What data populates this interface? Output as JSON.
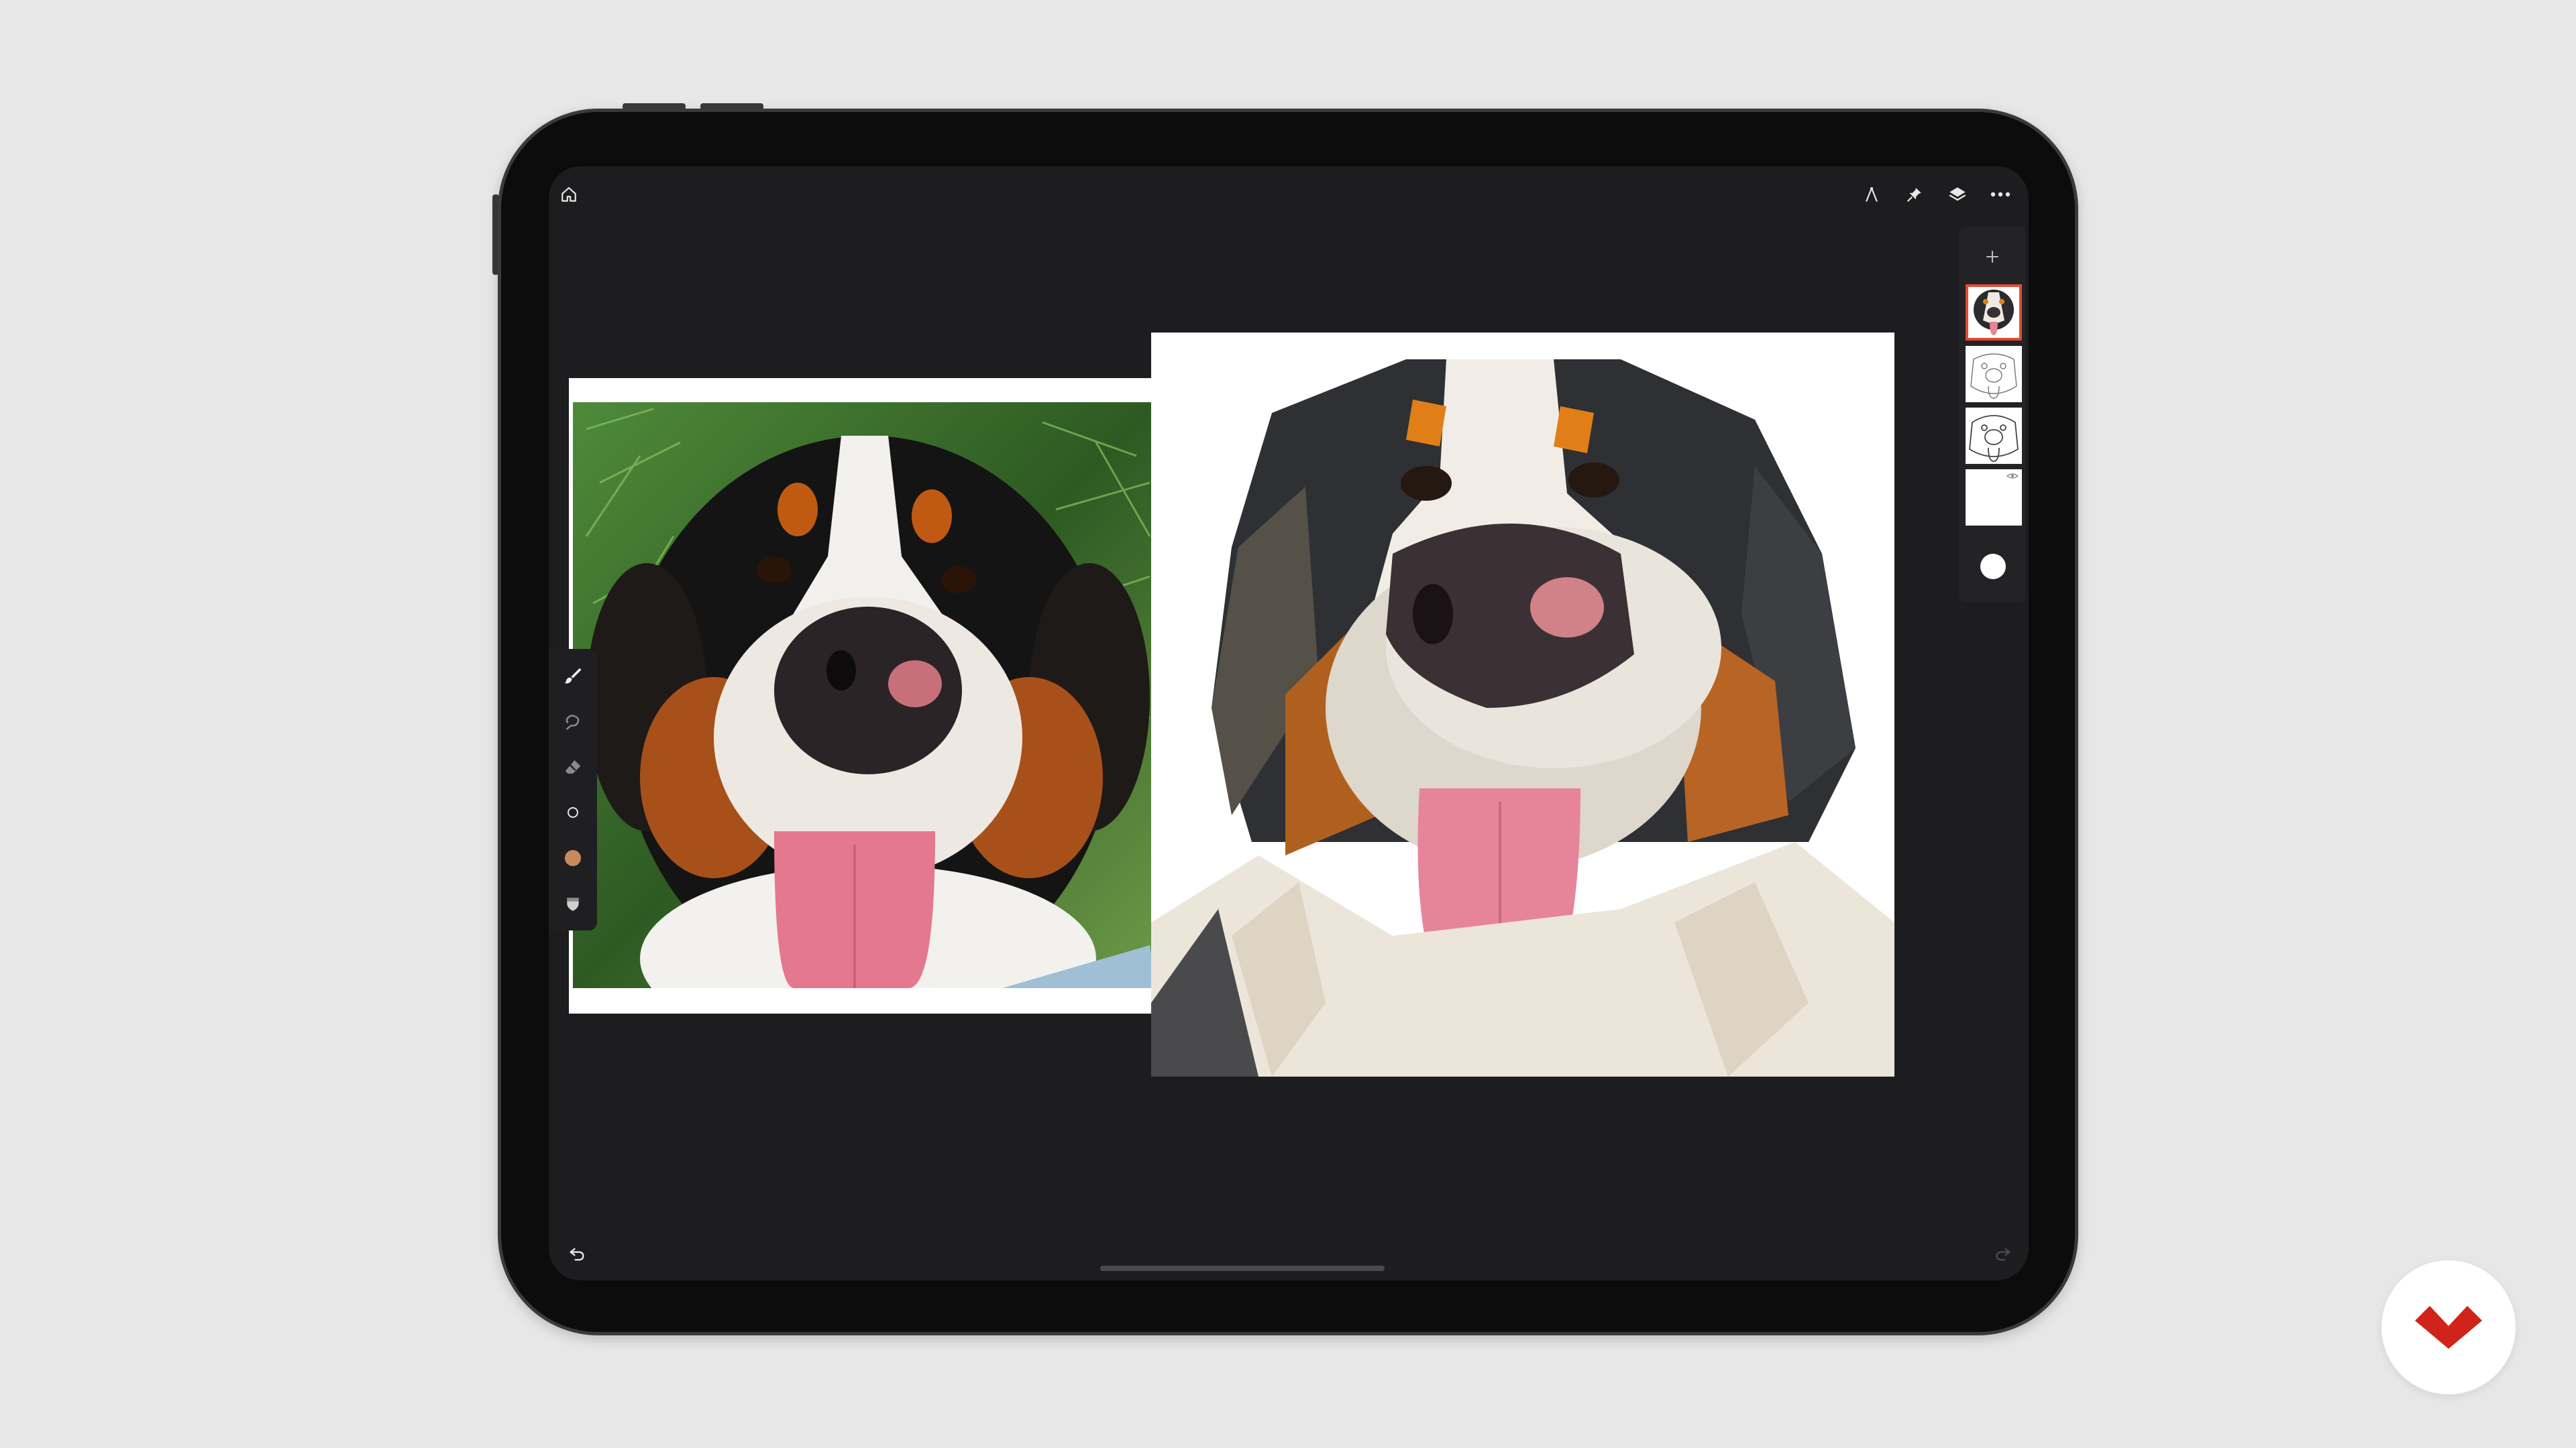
{
  "app": {
    "toolbar_left": [
      "home-icon"
    ],
    "toolbar_right": [
      "compass-icon",
      "pin-icon",
      "layers-icon",
      "more-icon"
    ],
    "undo_icon": "undo-icon",
    "redo_icon": "redo-icon"
  },
  "layers": {
    "add_icon": "plus-icon",
    "items": [
      {
        "thumb": "color-dog-portrait",
        "active": true
      },
      {
        "thumb": "line-sketch-1",
        "active": false
      },
      {
        "thumb": "line-sketch-2",
        "active": false
      },
      {
        "thumb": "blank-layer",
        "active": false
      }
    ],
    "visibility_icon": "eye-icon",
    "selected_color_icon": "color-dot"
  },
  "tools": [
    {
      "name": "brush-tool",
      "icon": "brush-icon"
    },
    {
      "name": "smudge-tool",
      "icon": "smudge-icon"
    },
    {
      "name": "eraser-tool",
      "icon": "eraser-icon"
    },
    {
      "name": "brush-size",
      "icon": "circle-icon"
    },
    {
      "name": "color-swatch",
      "icon": "swatch-icon"
    },
    {
      "name": "opacity",
      "icon": "shield-icon"
    }
  ],
  "colors": {
    "swatch": "#c98a5a",
    "active_layer_border": "#e24a32",
    "brand": "#d0241b"
  }
}
